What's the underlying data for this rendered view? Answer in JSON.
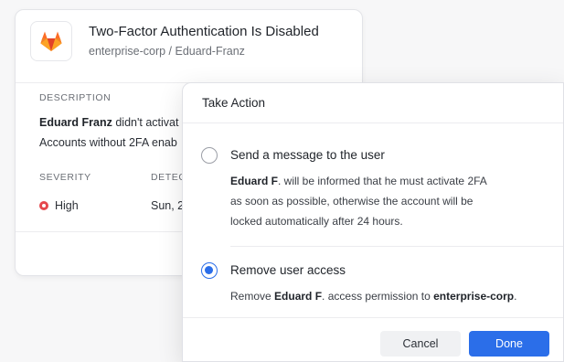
{
  "alert": {
    "title": "Two-Factor Authentication Is Disabled",
    "subtitle": "enterprise-corp / Eduard-Franz",
    "logo_icon": "gitlab-icon",
    "description_label": "DESCRIPTION",
    "description_user": "Eduard Franz",
    "description_line1_rest": " didn't activat",
    "description_line2": "Accounts without 2FA enab",
    "severity_label": "SEVERITY",
    "severity_value": "High",
    "severity_color": "#e5484d",
    "detected_label": "DETEC",
    "detected_value": "Sun, 2"
  },
  "modal": {
    "title": "Take Action",
    "options": [
      {
        "title": "Send a message to the user",
        "checked": false,
        "desc_user": "Eduard F",
        "desc_line1_rest": ". will be informed that he must activate 2FA",
        "desc_line2": "as soon as possible, otherwise the account will be",
        "desc_line3": "locked automatically after 24 hours."
      },
      {
        "title": "Remove user access",
        "checked": true,
        "desc_prefix": "Remove ",
        "desc_user": "Eduard F",
        "desc_middle": ". access permission to ",
        "desc_org": "enterprise-corp",
        "desc_suffix": "."
      }
    ],
    "cancel_label": "Cancel",
    "done_label": "Done",
    "accent_color": "#2b6ee9"
  }
}
